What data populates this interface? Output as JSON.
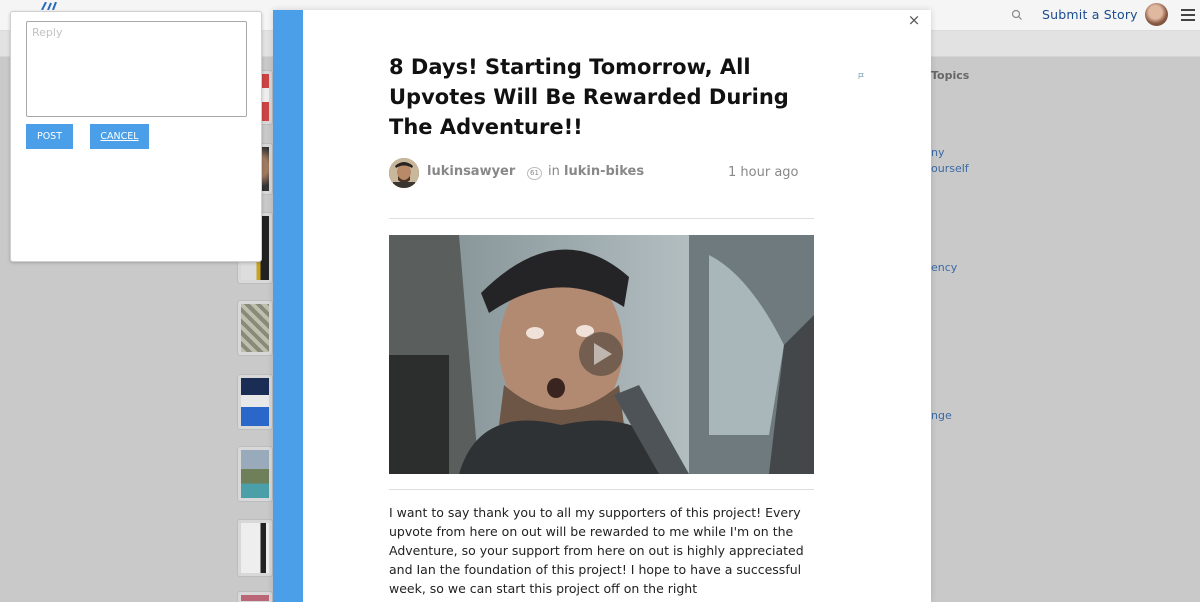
{
  "header": {
    "submit_label": "Submit a Story",
    "logo_icon": "steemit-logo-icon",
    "search_icon": "search-icon",
    "menu_icon": "hamburger-menu-icon"
  },
  "sidebar_right": {
    "title": "Topics",
    "links": [
      "ny",
      "ourself",
      "ency",
      "nge"
    ]
  },
  "post": {
    "title": "8 Days! Starting Tomorrow, All Upvotes Will Be Rewarded During The Adventure!!",
    "author": "lukinsawyer",
    "reputation": "61",
    "in_label": "in",
    "community": "lukin-bikes",
    "time": "1 hour ago",
    "body": "I want to say thank you to all my supporters of this project! Every upvote from here on out will be rewarded to me while I'm on the Adventure, so your support from here on out is highly appreciated and Ian the foundation of this project! I hope to have a successful week, so we can start this project off on the right"
  },
  "modal": {
    "close_label": "×",
    "accent_color": "#4a9fe8"
  },
  "reply": {
    "placeholder": "Reply",
    "value": "",
    "post_label": "POST",
    "cancel_label": "CANCEL"
  }
}
